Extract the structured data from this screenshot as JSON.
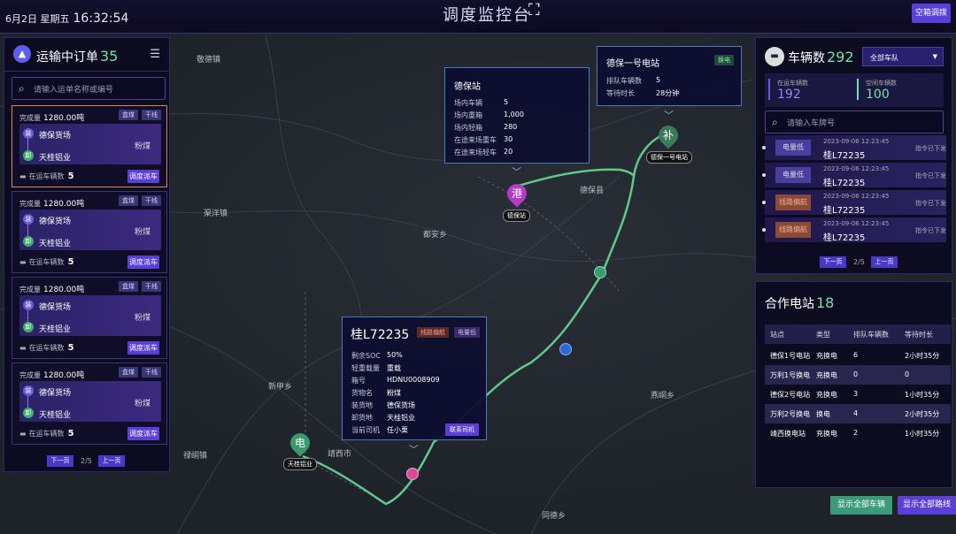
{
  "header": {
    "date": "6月2日",
    "weekday": "星期五",
    "time": "16:32:54",
    "title": "调度监控台",
    "ac_button": "空箱调拨",
    "fs_icon": "fullscreen-icon"
  },
  "map": {
    "places": [
      "敬德镇",
      "渠洋镇",
      "都安乡",
      "新甲乡",
      "禄峒镇",
      "靖西市",
      "同德乡",
      "燕峒乡",
      "德保县"
    ]
  },
  "orders": {
    "title": "运输中订单",
    "count": "35",
    "search_placeholder": "请输入运单名称或编号",
    "cards": [
      {
        "done_label": "完成量",
        "done_value": "1280.00吨",
        "tag1": "盒煤",
        "tag2": "干线",
        "load_badge": "装",
        "from": "德保货场",
        "unload_badge": "卸",
        "to": "天桂铝业",
        "cargo": "粉煤",
        "trucks_label": "在运车辆数",
        "trucks": "5",
        "button": "调度派车"
      },
      {
        "done_label": "完成量",
        "done_value": "1280.00吨",
        "tag1": "盒煤",
        "tag2": "干线",
        "load_badge": "装",
        "from": "德保货场",
        "unload_badge": "卸",
        "to": "天桂铝业",
        "cargo": "粉煤",
        "trucks_label": "在运车辆数",
        "trucks": "5",
        "button": "调度派车"
      },
      {
        "done_label": "完成量",
        "done_value": "1280.00吨",
        "tag1": "盒煤",
        "tag2": "干线",
        "load_badge": "装",
        "from": "德保货场",
        "unload_badge": "卸",
        "to": "天桂铝业",
        "cargo": "粉煤",
        "trucks_label": "在运车辆数",
        "trucks": "5",
        "button": "调度派车"
      },
      {
        "done_label": "完成量",
        "done_value": "1280.00吨",
        "tag1": "盒煤",
        "tag2": "干线",
        "load_badge": "装",
        "from": "德保货场",
        "unload_badge": "卸",
        "to": "天桂铝业",
        "cargo": "粉煤",
        "trucks_label": "在运车辆数",
        "trucks": "5",
        "button": "调度派车"
      }
    ],
    "pager": {
      "next": "下一页",
      "page": "2/5",
      "prev": "上一页"
    }
  },
  "station_popup": {
    "title": "德保站",
    "rows": [
      {
        "k": "场内车辆",
        "v": "5"
      },
      {
        "k": "场内重箱",
        "v": "1,000"
      },
      {
        "k": "场内轻箱",
        "v": "280"
      },
      {
        "k": "在途来场重车",
        "v": "30"
      },
      {
        "k": "在途来场轻车",
        "v": "20"
      }
    ]
  },
  "power_popup": {
    "title": "德保一号电站",
    "tag": "换电",
    "rows": [
      {
        "k": "排队车辆数",
        "v": "5"
      },
      {
        "k": "等待时长",
        "v": "28分钟"
      }
    ]
  },
  "truck_popup": {
    "plate": "桂L72235",
    "tag1": "线路偏航",
    "tag2": "电量低",
    "rows": [
      {
        "k": "剩余SOC",
        "v": "50%"
      },
      {
        "k": "轻重载量",
        "v": "重载"
      },
      {
        "k": "箱号",
        "v": "HDNU0008909"
      },
      {
        "k": "货物名",
        "v": "粉煤"
      },
      {
        "k": "装货地",
        "v": "德保货场"
      },
      {
        "k": "卸货地",
        "v": "天桂铝业"
      },
      {
        "k": "当前司机",
        "v": "任小栗"
      }
    ],
    "contact": "联系司机"
  },
  "pins": {
    "port": {
      "glyph": "港",
      "label": "德保站"
    },
    "supply": {
      "glyph": "补",
      "label": "德保一号电站"
    },
    "power": {
      "glyph": "电",
      "label": "天桂铝业"
    }
  },
  "vehicles": {
    "title": "车辆数",
    "count": "292",
    "fleet": "全部车队",
    "on_road_label": "在运车辆数",
    "on_road": "192",
    "idle_label": "空闲车辆数",
    "idle": "100",
    "search_placeholder": "请输入车牌号",
    "items": [
      {
        "status": "电量低",
        "time": "2023-09-06 12:23:45",
        "plate": "桂L72235",
        "cmd": "指令已下发",
        "type": "low"
      },
      {
        "status": "电量低",
        "time": "2023-09-06 12:23:45",
        "plate": "桂L72235",
        "cmd": "指令已下发",
        "type": "low"
      },
      {
        "status": "线路偏航",
        "time": "2023-09-06 12:23:45",
        "plate": "桂L72235",
        "cmd": "指令已下发",
        "type": "dev"
      },
      {
        "status": "线路偏航",
        "time": "2023-09-06 12:23:45",
        "plate": "桂L72235",
        "cmd": "指令已下发",
        "type": "dev"
      }
    ],
    "pager": {
      "next": "下一页",
      "page": "2/5",
      "prev": "上一页"
    }
  },
  "stations": {
    "title": "合作电站",
    "count": "18",
    "headers": [
      "站点",
      "类型",
      "排队车辆数",
      "等待时长"
    ],
    "rows": [
      [
        "德保1号电站",
        "充换电",
        "6",
        "2小时35分"
      ],
      [
        "万利1号换电",
        "充换电",
        "0",
        "0"
      ],
      [
        "德保2号电站",
        "充换电",
        "3",
        "1小时35分"
      ],
      [
        "万利2号换电",
        "换电",
        "4",
        "2小时35分"
      ],
      [
        "靖西换电站",
        "充换电",
        "2",
        "1小时35分"
      ]
    ]
  },
  "footer": {
    "show_vehicles": "显示全部车辆",
    "show_routes": "显示全部路线"
  },
  "colors": {
    "accent": "#5a3fd9",
    "green": "#6fe3a8",
    "route": "#5fc98a"
  }
}
